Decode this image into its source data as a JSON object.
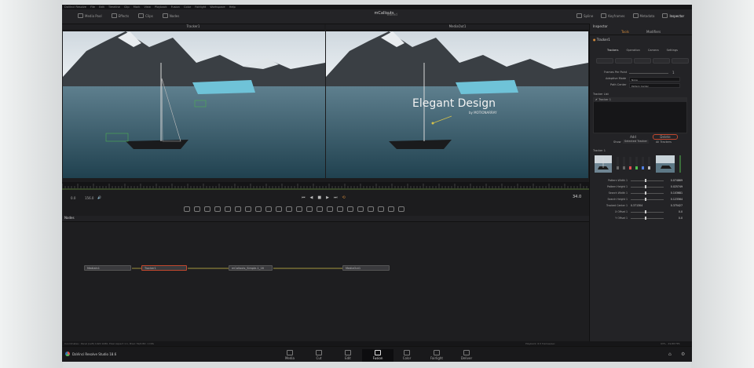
{
  "app": {
    "title": "mCallouts",
    "title_suffix": "Edited",
    "menu": [
      "DaVinci Resolve",
      "File",
      "Edit",
      "Timeline",
      "Clip",
      "Mark",
      "View",
      "Playback",
      "Fusion",
      "Color",
      "Fairlight",
      "Workspace",
      "Help"
    ],
    "left_tools": [
      {
        "label": "Media Pool",
        "icon": "media-pool-icon"
      },
      {
        "label": "Effects",
        "icon": "effects-icon"
      },
      {
        "label": "Clips",
        "icon": "clips-icon"
      },
      {
        "label": "Nodes",
        "icon": "nodes-icon"
      }
    ],
    "right_tools": [
      {
        "label": "Spline",
        "icon": "spline-icon"
      },
      {
        "label": "Keyframes",
        "icon": "keyframes-icon"
      },
      {
        "label": "Metadata",
        "icon": "metadata-icon"
      },
      {
        "label": "Inspector",
        "icon": "inspector-icon"
      }
    ]
  },
  "viewers": {
    "left": {
      "title": "Tracker1"
    },
    "right": {
      "title": "MediaOut1"
    },
    "overlay_title": "Elegant Design",
    "overlay_subtitle": "by MOTIONARRAY"
  },
  "transport": {
    "start": "0.0",
    "end": "156.0",
    "current": "34.0"
  },
  "nodes": {
    "panel_title": "Nodes",
    "items": [
      {
        "label": "MediaIn1"
      },
      {
        "label": "Tracker1"
      },
      {
        "label": "mCallouts_Simple-1_16"
      },
      {
        "label": "MediaOut1"
      }
    ]
  },
  "inspector": {
    "title": "Inspector",
    "tabs": [
      "Tools",
      "Modifiers"
    ],
    "tool_name": "Tracker1",
    "subtabs": [
      "Trackers",
      "Operation",
      "Camera",
      "Settings"
    ],
    "frames_per_point_label": "Frames Per Point",
    "frames_per_point_value": "1",
    "adaptive_mode_label": "Adaptive Mode",
    "adaptive_mode_value": "None",
    "path_center_label": "Path Center",
    "path_center_value": "Pattern Center",
    "tracker_list_label": "Tracker List",
    "tracker_list": [
      "Tracker 1"
    ],
    "add_label": "Add",
    "delete_label": "Delete",
    "show_label": "Show",
    "show_value": "Selected Tracker",
    "show_option2": "All Trackers",
    "tracker_header": "Tracker 1",
    "params": [
      {
        "label": "Pattern Width 1",
        "value": "0.074869"
      },
      {
        "label": "Pattern Height 1",
        "value": "0.025749"
      },
      {
        "label": "Search Width 1",
        "value": "0.103681"
      },
      {
        "label": "Search Height 1",
        "value": "0.123564"
      },
      {
        "label": "Tracked Center 1",
        "x": "0.371304",
        "value": "0.375427"
      },
      {
        "label": "X Offset 1",
        "value": "0.0"
      },
      {
        "label": "Y Offset 1",
        "value": "0.0"
      }
    ]
  },
  "status": {
    "left": "Coordinates : Panel (Left) 1920 1080, Pixel Aspect 1:1, Pixel: 59/4 Bit: 1 DPs",
    "middle": "Playback: 6.5 frames/sec",
    "right": "93% · 29.88 FPS"
  },
  "pages": [
    "Media",
    "Cut",
    "Edit",
    "Fusion",
    "Color",
    "Fairlight",
    "Deliver"
  ],
  "active_page": "Fusion",
  "brand": "DaVinci Resolve Studio 18.6",
  "colors": {
    "accent": "#d0883a",
    "selected_node": "#c0472e",
    "link": "#d6c24a"
  }
}
